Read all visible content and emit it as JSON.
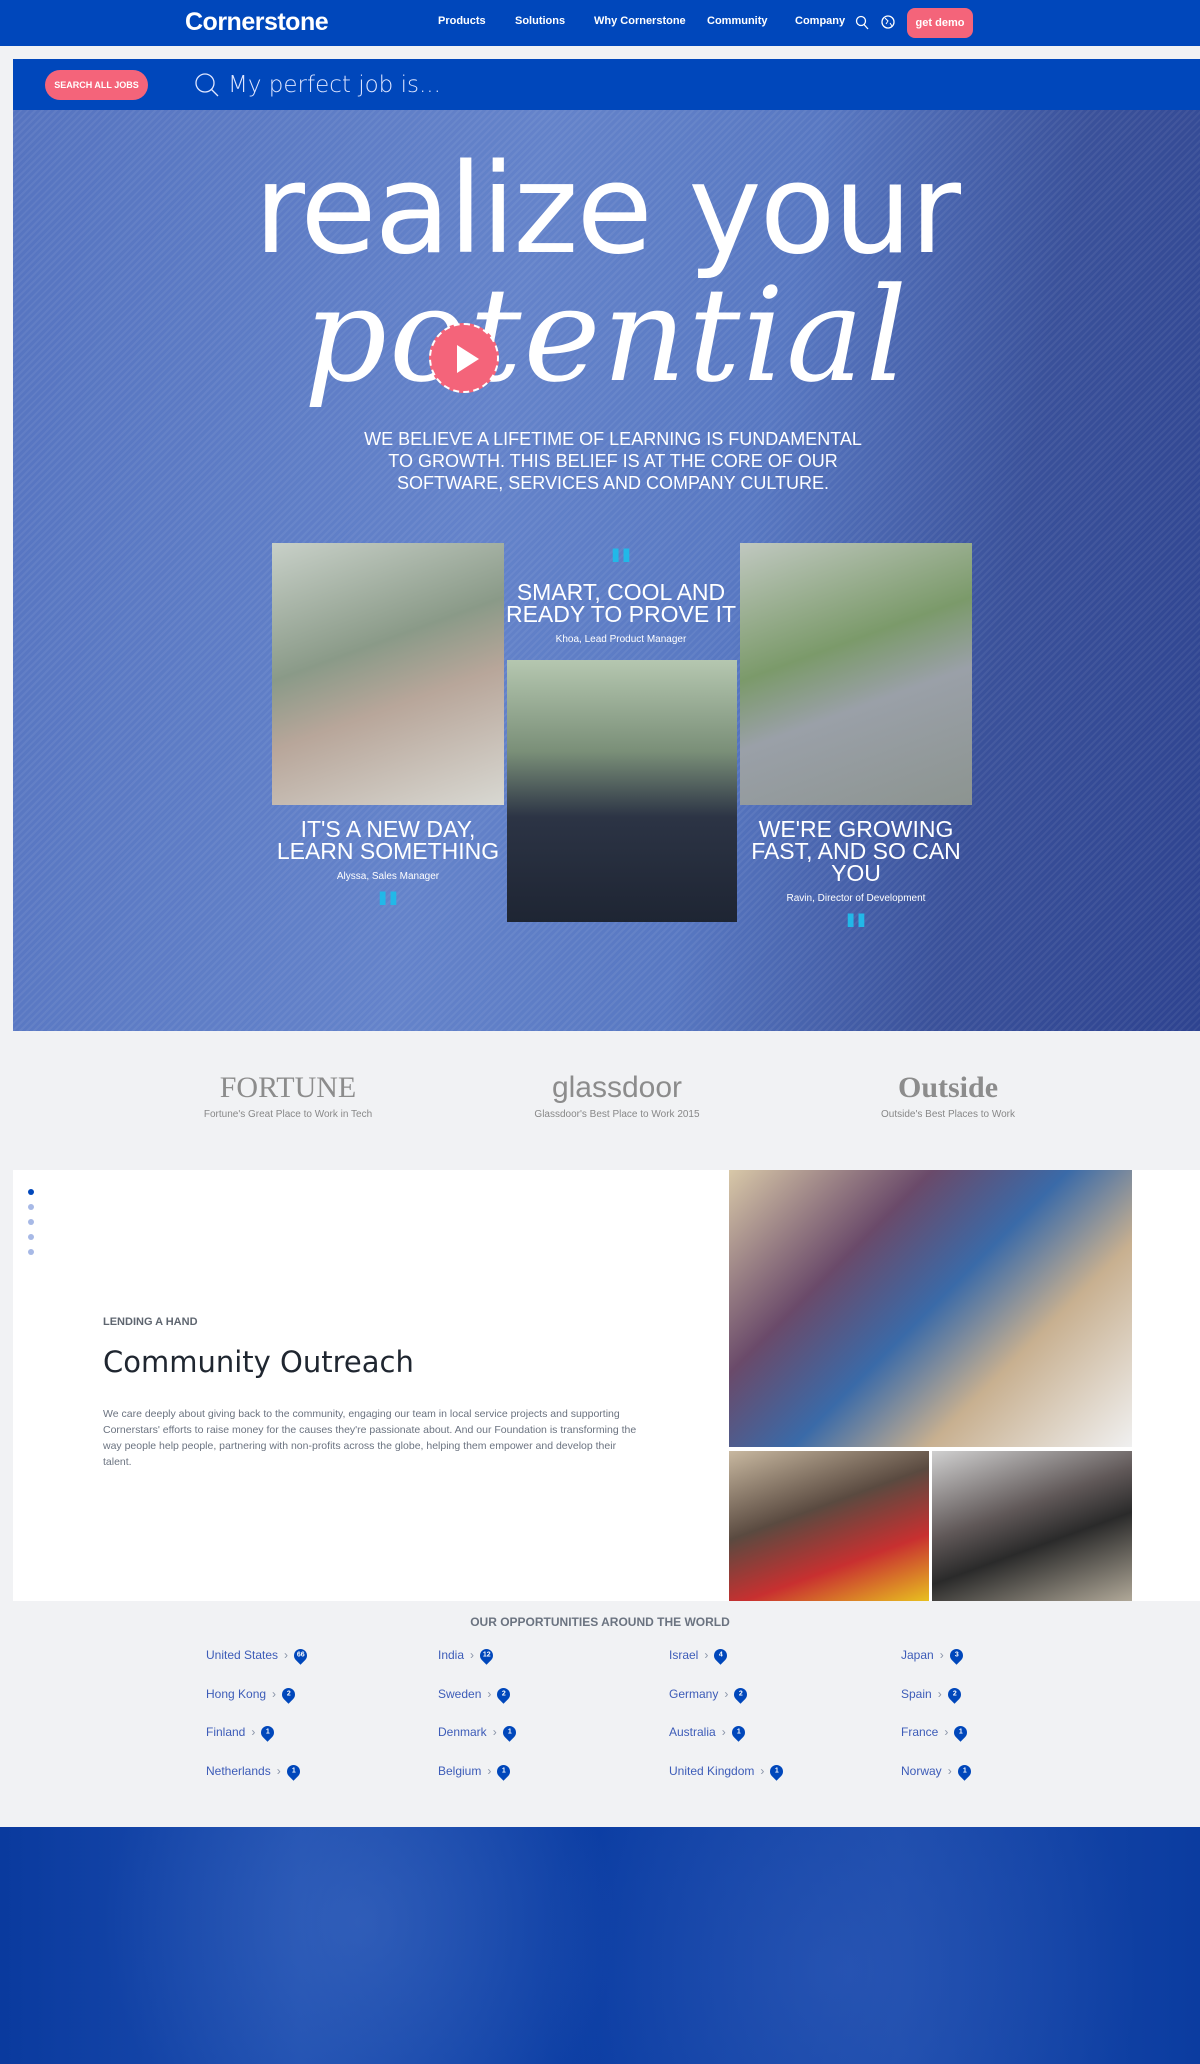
{
  "nav": {
    "logo": "Cornerstone",
    "items": [
      "Products",
      "Solutions",
      "Why Cornerstone",
      "Community",
      "Company"
    ],
    "demo": "get demo"
  },
  "search": {
    "button": "SEARCH ALL JOBS",
    "placeholder": "My perfect job is..."
  },
  "hero": {
    "line1": "realize your",
    "line2": "potential",
    "subtitle": "WE BELIEVE A LIFETIME OF LEARNING IS FUNDAMENTAL TO GROWTH. THIS BELIEF IS AT THE CORE OF OUR SOFTWARE, SERVICES AND COMPANY CULTURE.",
    "cards": [
      {
        "title": "IT'S A NEW DAY, LEARN SOMETHING",
        "name": "Alyssa, Sales Manager"
      },
      {
        "title": "SMART, COOL AND READY TO PROVE IT",
        "name": "Khoa, Lead Product Manager"
      },
      {
        "title": "WE'RE GROWING FAST, AND SO CAN YOU",
        "name": "Ravin, Director of Development"
      }
    ]
  },
  "awards": [
    {
      "logo": "FORTUNE",
      "caption": "Fortune's Great Place to Work in Tech"
    },
    {
      "logo": "glassdoor",
      "caption": "Glassdoor's Best Place to Work 2015"
    },
    {
      "logo": "Outside",
      "caption": "Outside's Best Places to Work"
    }
  ],
  "community": {
    "eyebrow": "LENDING A HAND",
    "title": "Community Outreach",
    "body": "We care deeply about giving back to the community, engaging our team in local service projects and supporting Cornerstars' efforts to raise money for the causes they're passionate about. And our Foundation is transforming the way people help people, partnering with non-profits across the globe, helping them empower and develop their talent.",
    "slides": 5,
    "active_slide": 1
  },
  "world": {
    "title": "OUR OPPORTUNITIES AROUND THE WORLD",
    "countries": [
      {
        "name": "United States",
        "count": "66"
      },
      {
        "name": "India",
        "count": "12"
      },
      {
        "name": "Israel",
        "count": "4"
      },
      {
        "name": "Japan",
        "count": "3"
      },
      {
        "name": "Hong Kong",
        "count": "2"
      },
      {
        "name": "Sweden",
        "count": "2"
      },
      {
        "name": "Germany",
        "count": "2"
      },
      {
        "name": "Spain",
        "count": "2"
      },
      {
        "name": "Finland",
        "count": "1"
      },
      {
        "name": "Denmark",
        "count": "1"
      },
      {
        "name": "Australia",
        "count": "1"
      },
      {
        "name": "France",
        "count": "1"
      },
      {
        "name": "Netherlands",
        "count": "1"
      },
      {
        "name": "Belgium",
        "count": "1"
      },
      {
        "name": "United Kingdom",
        "count": "1"
      },
      {
        "name": "Norway",
        "count": "1"
      }
    ]
  },
  "colors": {
    "brand": "#0047bb",
    "accent": "#f4647a",
    "quote": "#22b8e8"
  }
}
